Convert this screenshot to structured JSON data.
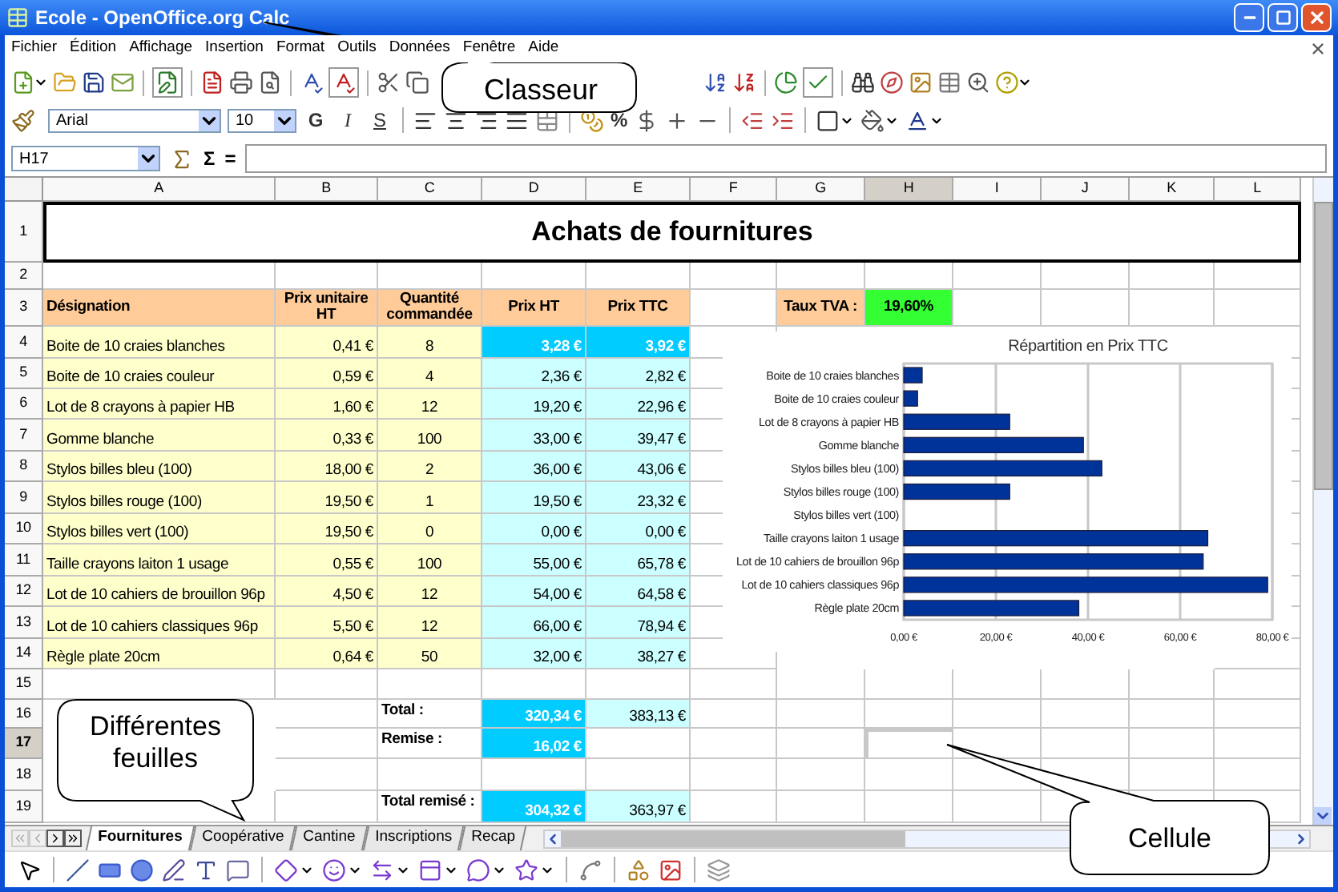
{
  "window": {
    "title": "Ecole - OpenOffice.org Calc"
  },
  "menu": [
    "Fichier",
    "Édition",
    "Affichage",
    "Insertion",
    "Format",
    "Outils",
    "Données",
    "Fenêtre",
    "Aide"
  ],
  "format_bar": {
    "font": "Arial",
    "size": "10",
    "styles": [
      "G",
      "I",
      "S"
    ],
    "percent": "%"
  },
  "formula_bar": {
    "cell": "H17",
    "sum": "Σ",
    "equals": "="
  },
  "columns": [
    {
      "label": "A",
      "selected": false
    },
    {
      "label": "B",
      "selected": false
    },
    {
      "label": "C",
      "selected": false
    },
    {
      "label": "D",
      "selected": false
    },
    {
      "label": "E",
      "selected": false
    },
    {
      "label": "F",
      "selected": false
    },
    {
      "label": "G",
      "selected": false
    },
    {
      "label": "H",
      "selected": true
    },
    {
      "label": "I",
      "selected": false
    },
    {
      "label": "J",
      "selected": false
    },
    {
      "label": "K",
      "selected": false
    },
    {
      "label": "L",
      "selected": false
    }
  ],
  "row_numbers": [
    {
      "label": "1",
      "selected": false
    },
    {
      "label": "2",
      "selected": false
    },
    {
      "label": "3",
      "selected": false
    },
    {
      "label": "4",
      "selected": false
    },
    {
      "label": "5",
      "selected": false
    },
    {
      "label": "6",
      "selected": false
    },
    {
      "label": "7",
      "selected": false
    },
    {
      "label": "8",
      "selected": false
    },
    {
      "label": "9",
      "selected": false
    },
    {
      "label": "10",
      "selected": false
    },
    {
      "label": "11",
      "selected": false
    },
    {
      "label": "12",
      "selected": false
    },
    {
      "label": "13",
      "selected": false
    },
    {
      "label": "14",
      "selected": false
    },
    {
      "label": "15",
      "selected": false
    },
    {
      "label": "16",
      "selected": false
    },
    {
      "label": "17",
      "selected": true
    },
    {
      "label": "18",
      "selected": false
    },
    {
      "label": "19",
      "selected": false
    }
  ],
  "sheet": {
    "title": "Achats de fournitures",
    "headers": [
      "Désignation",
      "Prix unitaire HT",
      "Quantité commandée",
      "Prix HT",
      "Prix TTC"
    ],
    "vat": {
      "label": "Taux TVA :",
      "value": "19,60%"
    },
    "rows": [
      {
        "cells": [
          "Boite de 10 craies blanches",
          "0,41 €",
          "8",
          "3,28 €",
          "3,92 €"
        ],
        "highlighted": true
      },
      {
        "cells": [
          "Boite de 10 craies couleur",
          "0,59 €",
          "4",
          "2,36 €",
          "2,82 €"
        ],
        "highlighted": false
      },
      {
        "cells": [
          "Lot de 8 crayons à papier HB",
          "1,60 €",
          "12",
          "19,20 €",
          "22,96 €"
        ],
        "highlighted": false
      },
      {
        "cells": [
          "Gomme blanche",
          "0,33 €",
          "100",
          "33,00 €",
          "39,47 €"
        ],
        "highlighted": false
      },
      {
        "cells": [
          "Stylos billes bleu (100)",
          "18,00 €",
          "2",
          "36,00 €",
          "43,06 €"
        ],
        "highlighted": false
      },
      {
        "cells": [
          "Stylos billes rouge (100)",
          "19,50 €",
          "1",
          "19,50 €",
          "23,32 €"
        ],
        "highlighted": false
      },
      {
        "cells": [
          "Stylos billes vert (100)",
          "19,50 €",
          "0",
          "0,00 €",
          "0,00 €"
        ],
        "highlighted": false
      },
      {
        "cells": [
          "Taille crayons laiton 1 usage",
          "0,55 €",
          "100",
          "55,00 €",
          "65,78 €"
        ],
        "highlighted": false
      },
      {
        "cells": [
          "Lot de 10 cahiers de brouillon 96p",
          "4,50 €",
          "12",
          "54,00 €",
          "64,58 €"
        ],
        "highlighted": false
      },
      {
        "cells": [
          "Lot de 10 cahiers classiques 96p",
          "5,50 €",
          "12",
          "66,00 €",
          "78,94 €"
        ],
        "highlighted": false
      },
      {
        "cells": [
          "Règle plate 20cm",
          "0,64 €",
          "50",
          "32,00 €",
          "38,27 €"
        ],
        "highlighted": false
      }
    ],
    "totals": [
      {
        "label": "Total :",
        "ht": "320,34 €",
        "ttc": "383,13 €"
      },
      {
        "label": "Remise :",
        "ht": "16,02 €"
      },
      {
        "label": "Total remisé :",
        "ht": "304,32 €",
        "ttc": "363,97 €"
      }
    ],
    "chart_data": {
      "type": "bar",
      "orientation": "horizontal",
      "title": "Répartition en Prix TTC",
      "categories": [
        "Boite de 10 craies blanches",
        "Boite de 10 craies couleur",
        "Lot de 8 crayons à papier HB",
        "Gomme blanche",
        "Stylos billes bleu (100)",
        "Stylos billes rouge (100)",
        "Stylos billes vert (100)",
        "Taille crayons laiton 1 usage",
        "Lot de 10 cahiers de brouillon 96p",
        "Lot de 10 cahiers classiques 96p",
        "Règle plate 20cm"
      ],
      "series": [
        {
          "color": "#003399",
          "values": [
            4,
            3,
            23,
            39,
            43,
            23,
            0,
            66,
            65,
            79,
            38
          ]
        }
      ],
      "grid": true,
      "xlim": [
        0,
        80
      ],
      "xticks": [
        {
          "value": 0,
          "label": "0,00 €"
        },
        {
          "value": 20,
          "label": "20,00 €"
        },
        {
          "value": 40,
          "label": "40,00 €"
        },
        {
          "value": 60,
          "label": "60,00 €"
        },
        {
          "value": 80,
          "label": "80,00 €"
        }
      ]
    }
  },
  "sheet_tabs": [
    {
      "label": "Fournitures",
      "selected": true
    },
    {
      "label": "Coopérative",
      "selected": false
    },
    {
      "label": "Cantine",
      "selected": false
    },
    {
      "label": "Inscriptions",
      "selected": false
    },
    {
      "label": "Recap",
      "selected": false
    }
  ],
  "callouts": [
    "Classeur",
    "Différentes feuilles",
    "Cellule"
  ]
}
